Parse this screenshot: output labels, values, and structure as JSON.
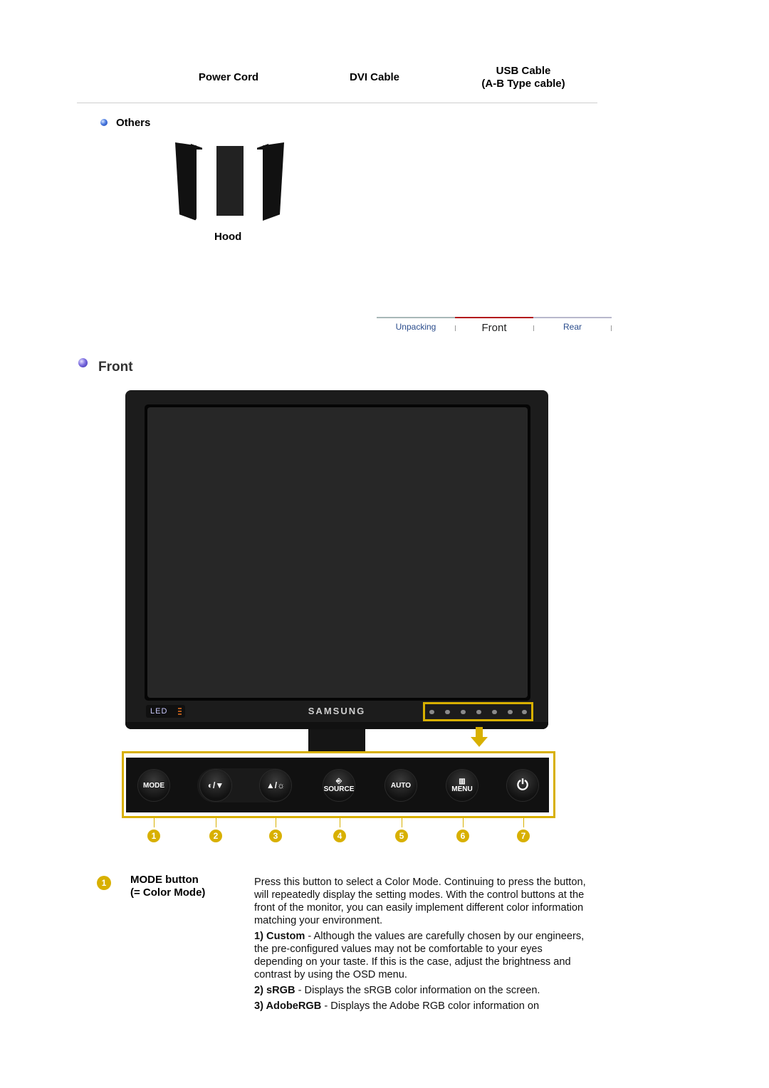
{
  "accessories": {
    "cables": [
      {
        "label": "Power Cord"
      },
      {
        "label": "DVI Cable"
      },
      {
        "label_line1": "USB Cable",
        "label_line2": "(A-B Type cable)"
      }
    ],
    "others_heading": "Others",
    "others_items": [
      {
        "label": "Hood"
      }
    ]
  },
  "nav": {
    "tabs": [
      {
        "label": "Unpacking",
        "active": false
      },
      {
        "label": "Front",
        "active": true
      },
      {
        "label": "Rear",
        "active": false
      }
    ],
    "active_color": "#b3151c"
  },
  "front_section": {
    "title": "Front",
    "monitor": {
      "brand": "SAMSUNG",
      "led_badge": "LED"
    },
    "buttons": [
      {
        "number": "1",
        "label": "MODE",
        "icon": "mode-text"
      },
      {
        "number": "2",
        "label": "◐/▼",
        "icon": "contrast-down-icon"
      },
      {
        "number": "3",
        "label": "▲/☼",
        "icon": "up-brightness-icon"
      },
      {
        "number": "4",
        "label": "SOURCE",
        "icon": "source-icon"
      },
      {
        "number": "5",
        "label": "AUTO",
        "icon": "auto-text"
      },
      {
        "number": "6",
        "label": "MENU",
        "icon": "menu-icon"
      },
      {
        "number": "7",
        "label": "⏻",
        "icon": "power-icon"
      }
    ],
    "highlight_color": "#d8b000"
  },
  "descriptions": [
    {
      "number": "1",
      "title_line1": "MODE button",
      "title_line2": "(= Color Mode)",
      "intro": "Press this button to select a Color Mode. Continuing to press the button, will repeatedly display the setting modes. With the control buttons at the front of the monitor, you can easily implement different color information matching your environment.",
      "modes": [
        {
          "label": "1) Custom",
          "text": " - Although the values are carefully chosen by our engineers, the pre-configured values may not be comfortable to your eyes depending on your taste. If this is the case, adjust the brightness and contrast by using the OSD menu."
        },
        {
          "label": "2) sRGB",
          "text": " - Displays the sRGB color information on the screen."
        },
        {
          "label": "3) AdobeRGB",
          "text": " - Displays the Adobe RGB color information on"
        }
      ]
    }
  ]
}
